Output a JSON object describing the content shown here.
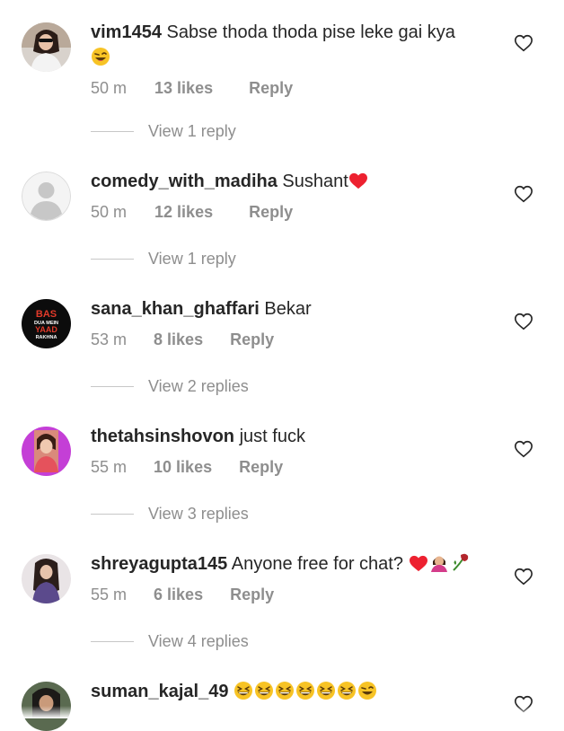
{
  "comments": [
    {
      "username": "vim1454",
      "text": "Sabse thoda thoda pise leke gai kya",
      "emoji": "😜",
      "time": "50 m",
      "likes": "13 likes",
      "reply": "Reply",
      "view_replies": "View 1 reply",
      "avatar_icon": "profile-photo"
    },
    {
      "username": "comedy_with_madiha",
      "text": "Sushant",
      "emoji": "❤️",
      "time": "50 m",
      "likes": "12 likes",
      "reply": "Reply",
      "view_replies": "View 1 reply",
      "avatar_icon": "default-avatar-icon"
    },
    {
      "username": "sana_khan_ghaffari",
      "text": "Bekar",
      "emoji": "",
      "time": "53 m",
      "likes": "8 likes",
      "reply": "Reply",
      "view_replies": "View 2 replies",
      "avatar_icon": "profile-photo",
      "avatar_text": [
        "BAS",
        "DUA MEIN",
        "YAAD",
        "RAKHNA"
      ]
    },
    {
      "username": "thetahsinshovon",
      "text": "just fuck",
      "emoji": "",
      "time": "55 m",
      "likes": "10 likes",
      "reply": "Reply",
      "view_replies": "View 3 replies",
      "avatar_icon": "profile-photo"
    },
    {
      "username": "shreyagupta145",
      "text": "Anyone free for chat?",
      "emoji": "❤️💁‍♀️🥀",
      "time": "55 m",
      "likes": "6 likes",
      "reply": "Reply",
      "view_replies": "View 4 replies",
      "avatar_icon": "profile-photo"
    },
    {
      "username": "suman_kajal_49",
      "text": "",
      "emoji": "😆😆😆😆😆😆😜",
      "avatar_icon": "profile-photo"
    }
  ],
  "icons": {
    "like": "heart-outline-icon"
  },
  "colors": {
    "text": "#262626",
    "secondary": "#8e8e8e",
    "divider": "#c7c7c7",
    "heart_red": "#ed4956"
  }
}
